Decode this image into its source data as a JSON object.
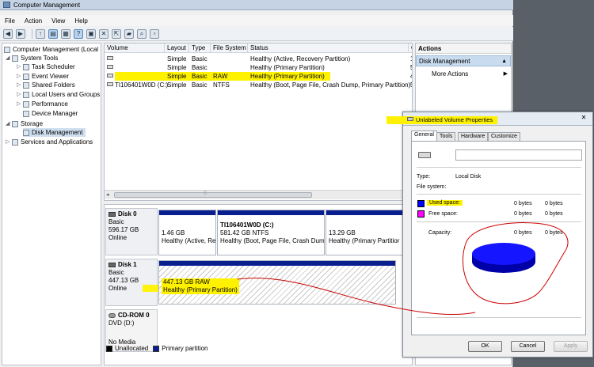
{
  "window": {
    "title": "Computer Management"
  },
  "menu": [
    "File",
    "Action",
    "View",
    "Help"
  ],
  "toolbar": {
    "icons": [
      "back-icon",
      "forward-icon",
      "up-icon",
      "show-hide-tree-icon",
      "properties-icon",
      "help-icon",
      "connect-icon",
      "delete-icon",
      "export-icon",
      "open-icon",
      "search-icon",
      "more-icon"
    ]
  },
  "tree": {
    "root": "Computer Management (Local",
    "system_tools": "System Tools",
    "task_scheduler": "Task Scheduler",
    "event_viewer": "Event Viewer",
    "shared_folders": "Shared Folders",
    "local_users": "Local Users and Groups",
    "performance": "Performance",
    "device_manager": "Device Manager",
    "storage": "Storage",
    "disk_management": "Disk Management",
    "services": "Services and Applications"
  },
  "volumes": {
    "headers": [
      "Volume",
      "Layout",
      "Type",
      "File System",
      "Status",
      "C"
    ],
    "rows": [
      {
        "volume": "",
        "layout": "Simple",
        "type": "Basic",
        "fs": "",
        "status": "Healthy (Active, Recovery Partition)",
        "c": "1"
      },
      {
        "volume": "",
        "layout": "Simple",
        "type": "Basic",
        "fs": "",
        "status": "Healthy (Primary Partition)",
        "c": "5"
      },
      {
        "volume": "",
        "layout": "Simple",
        "type": "Basic",
        "fs": "RAW",
        "status": "Healthy (Primary Partition)",
        "c": "4"
      },
      {
        "volume": "TI106401W0D (C:)",
        "layout": "Simple",
        "type": "Basic",
        "fs": "NTFS",
        "status": "Healthy (Boot, Page File, Crash Dump, Primary Partition)",
        "c": "5"
      }
    ]
  },
  "disks": {
    "disk0": {
      "name": "Disk 0",
      "kind": "Basic",
      "size": "596.17 GB",
      "state": "Online",
      "p1_size": "1.46 GB",
      "p1_status": "Healthy (Active, Re",
      "p2_name": "TI106401W0D  (C:)",
      "p2_size": "581.42 GB NTFS",
      "p2_status": "Healthy (Boot, Page File, Crash Dum",
      "p3_size": "13.29 GB",
      "p3_status": "Healthy (Primary Partitior"
    },
    "disk1": {
      "name": "Disk 1",
      "kind": "Basic",
      "size": "447.13 GB",
      "state": "Online",
      "p1_size": "447.13 GB RAW",
      "p1_status": "Healthy (Primary Partition)"
    },
    "cdrom": {
      "name": "CD-ROM 0",
      "kind": "DVD (D:)",
      "media": "No Media"
    }
  },
  "legend": {
    "unallocated": "Unallocated",
    "primary": "Primary partition"
  },
  "actions": {
    "header": "Actions",
    "section": "Disk Management",
    "more": "More Actions"
  },
  "dialog": {
    "title": "Unlabeled Volume Properties",
    "tabs": [
      "General",
      "Tools",
      "Hardware",
      "Customize"
    ],
    "type_label": "Type:",
    "type_value": "Local Disk",
    "fs_label": "File system:",
    "used_label": "Used space:",
    "used_bytes1": "0 bytes",
    "used_bytes2": "0 bytes",
    "free_label": "Free space:",
    "free_bytes1": "0 bytes",
    "free_bytes2": "0 bytes",
    "cap_label": "Capacity:",
    "cap_bytes1": "0 bytes",
    "cap_bytes2": "0 bytes",
    "ok": "OK",
    "cancel": "Cancel",
    "apply": "Apply"
  },
  "colors": {
    "primary_partition": "#0a1f8f",
    "used": "#0000ff",
    "free": "#ff00ff",
    "highlight": "#fff200",
    "annotation": "#cc0000"
  }
}
